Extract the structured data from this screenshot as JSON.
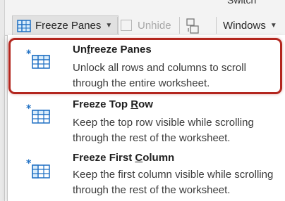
{
  "ribbon": {
    "freeze_label": "Freeze Panes",
    "unhide_label": "Unhide",
    "switch_label": "Switch",
    "windows_label": "Windows"
  },
  "menu": {
    "items": [
      {
        "title_before": "Un",
        "title_underline": "f",
        "title_after": "reeze Panes",
        "description": "Unlock all rows and columns to scroll through the entire worksheet."
      },
      {
        "title_before": "Freeze Top ",
        "title_underline": "R",
        "title_after": "ow",
        "description": "Keep the top row visible while scrolling through the rest of the worksheet."
      },
      {
        "title_before": "Freeze First ",
        "title_underline": "C",
        "title_after": "olumn",
        "description": "Keep the first column visible while scrolling through the rest of the worksheet."
      }
    ]
  },
  "colors": {
    "accent_blue": "#1e6fc3",
    "highlight_red": "#b3261e",
    "icon_fill": "#d8ecfb"
  },
  "icons": [
    "freeze-panes-icon",
    "chevron-down-icon",
    "unhide-icon",
    "switch-windows-icon",
    "unfreeze-panes-icon",
    "freeze-top-row-icon",
    "freeze-first-column-icon"
  ]
}
